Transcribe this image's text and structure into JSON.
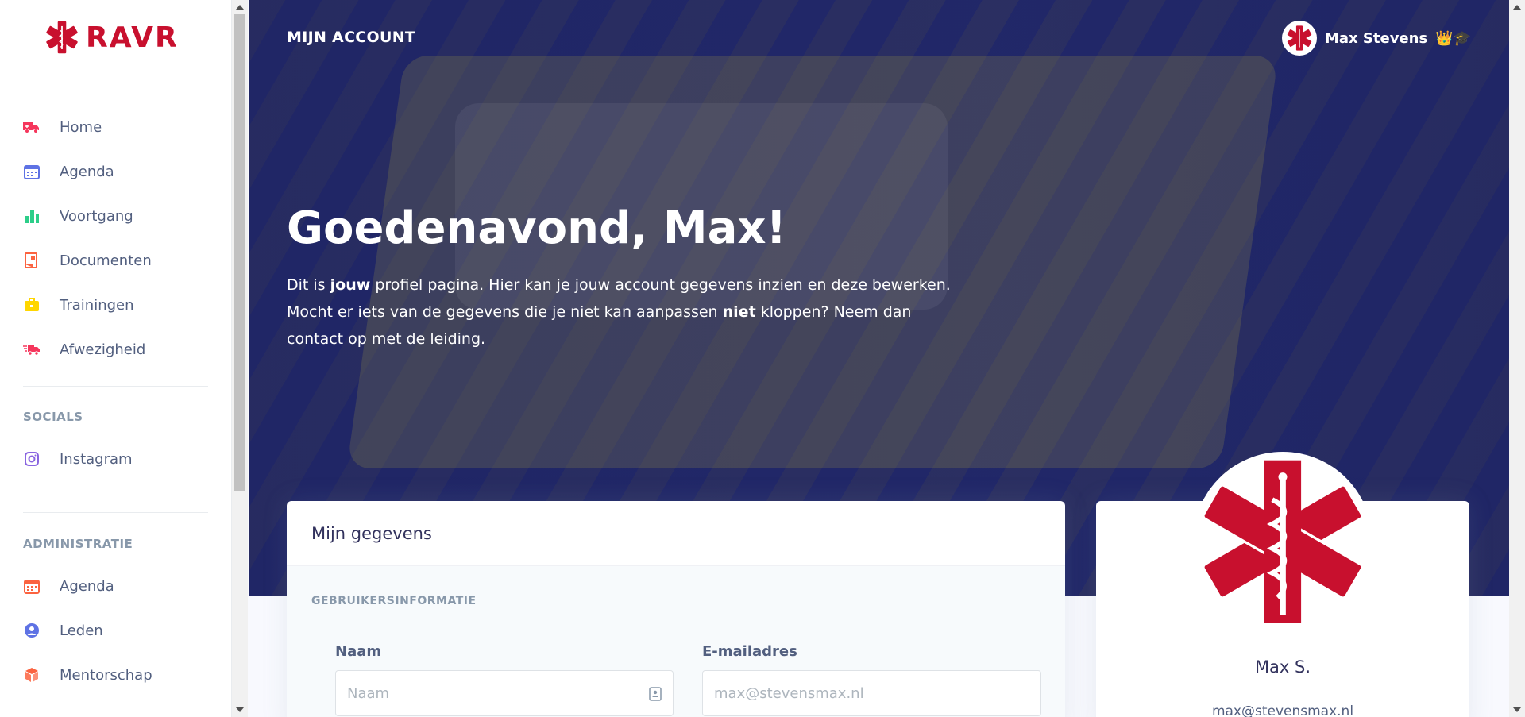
{
  "brand": {
    "name": "RAVR",
    "color": "#c8102e"
  },
  "sidebar": {
    "items": [
      {
        "label": "Home",
        "icon": "ambulance-icon",
        "color": "#f5365c"
      },
      {
        "label": "Agenda",
        "icon": "calendar-icon",
        "color": "#5e72e4"
      },
      {
        "label": "Voortgang",
        "icon": "bar-chart-icon",
        "color": "#2dce89"
      },
      {
        "label": "Documenten",
        "icon": "document-icon",
        "color": "#fb6340"
      },
      {
        "label": "Trainingen",
        "icon": "briefcase-icon",
        "color": "#ffd600"
      },
      {
        "label": "Afwezigheid",
        "icon": "truck-fast-icon",
        "color": "#f5365c"
      }
    ],
    "socials": {
      "heading": "SOCIALS",
      "items": [
        {
          "label": "Instagram",
          "icon": "instagram-icon",
          "color": "#8965e0"
        }
      ]
    },
    "admin": {
      "heading": "ADMINISTRATIE",
      "items": [
        {
          "label": "Agenda",
          "icon": "calendar-icon",
          "color": "#fb6340"
        },
        {
          "label": "Leden",
          "icon": "user-circle-icon",
          "color": "#5e72e4"
        },
        {
          "label": "Mentorschap",
          "icon": "cube-icon",
          "color": "#fb6340"
        }
      ]
    }
  },
  "header": {
    "title": "MIJN ACCOUNT",
    "user_name": "Max Stevens",
    "user_badges": "👑🎓"
  },
  "hero": {
    "greeting": "Goedenavond, Max!",
    "intro_1": "Dit is ",
    "intro_b1": "jouw",
    "intro_2": " profiel pagina. Hier kan je jouw account gegevens inzien en deze bewerken. Mocht er iets van de gegevens die je niet kan aanpassen ",
    "intro_b2": "niet",
    "intro_3": " kloppen? Neem dan contact op met de leiding."
  },
  "form": {
    "card_title": "Mijn gegevens",
    "section": "GEBRUIKERSINFORMATIE",
    "name_label": "Naam",
    "name_placeholder": "Naam",
    "email_label": "E-mailadres",
    "email_placeholder": "max@stevensmax.nl"
  },
  "profile": {
    "name": "Max S.",
    "email": "max@stevensmax.nl"
  }
}
